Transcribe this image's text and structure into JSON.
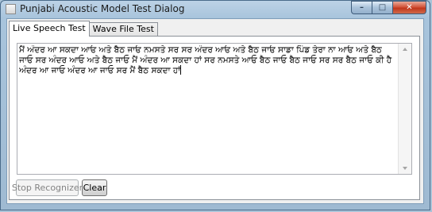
{
  "window": {
    "title": "Punjabi Acoustic Model Test Dialog"
  },
  "caption": {
    "minimize": "–",
    "maximize": "□",
    "close": "✕"
  },
  "tabs": [
    {
      "label": "Live Speech Test",
      "active": true
    },
    {
      "label": "Wave File Test",
      "active": false
    }
  ],
  "textbox": {
    "value": "ਮੈਂ ਅੰਦਰ ਆ ਸਕਦਾ ਆਓ ਅਤੇ ਬੈਠ ਜਾਓ ਨਮਸਤੇ ਸਰ ਸਰ ਅੰਦਰ ਆਓ ਅਤੇ ਬੈਠ ਜਾਓ ਸਾਡਾ ਪਿੰਡ ਤੇਰਾ ਨਾ ਆਓ ਅਤੇ ਬੈਠ ਜਾਓ ਸਰ ਅੰਦਰ ਆਓ ਅਤੇ ਬੈਠ ਜਾਓ ਮੈਂ ਅੰਦਰ ਆ ਸਕਦਾ ਹਾਂ ਸਰ ਨਮਸਤੇ ਆਓ ਬੈਠ ਜਾਓ ਬੈਠ ਜਾਓ ਸਰ ਸਰ ਬੈਠ ਜਾਓ ਕੀ ਹੈ ਅੰਦਰ ਆ ਜਾਓ ਅੰਦਰ ਆ ਜਾਓ ਸਰ ਮੈਂ ਬੈਠ ਸਕਦਾ ਹਾਂ"
  },
  "buttons": {
    "stop_label": "Stop Recognizer",
    "stop_enabled": false,
    "clear_label": "Clear",
    "clear_enabled": true
  },
  "colors": {
    "accent": "#a8c4dc",
    "close": "#c1371c"
  }
}
